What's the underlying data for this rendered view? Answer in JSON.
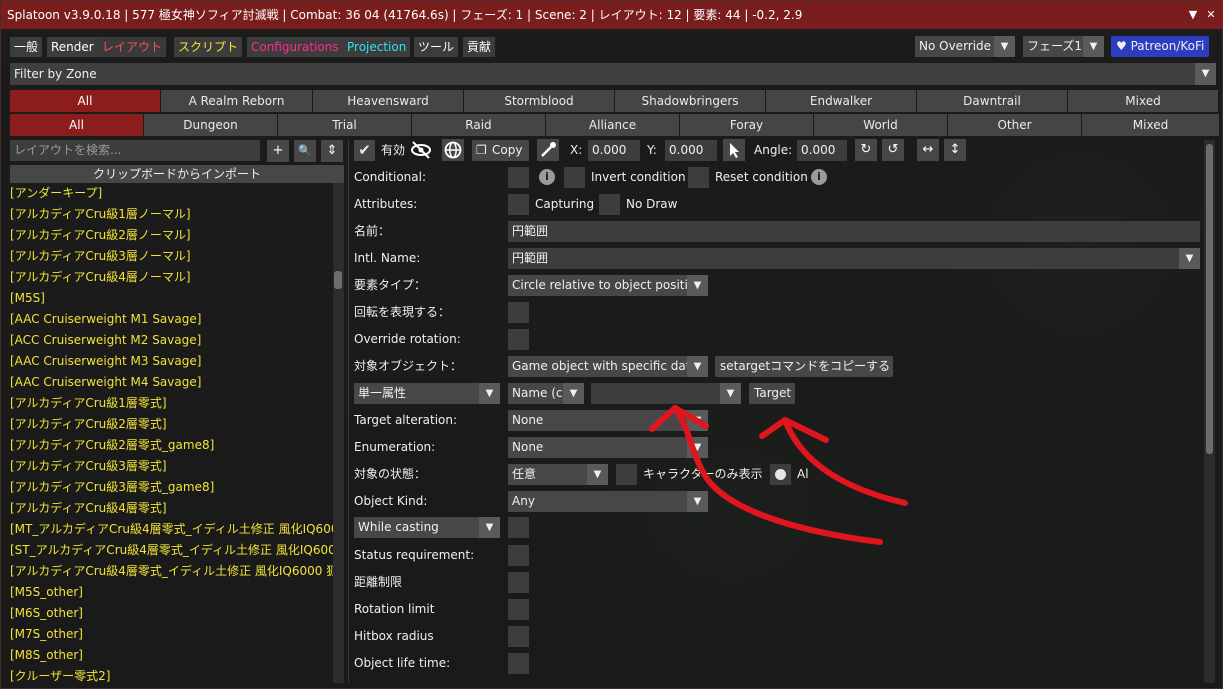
{
  "window": {
    "title": "Splatoon v3.9.0.18 | 577 極女神ソフィア討滅戦 | Combat: 36 04 (41764.6s) | フェーズ: 1 | Scene: 2 | レイアウト: 12 | 要素: 44 | -0.2, 2.9",
    "collapse_glyph": "▼",
    "close_glyph": "✕"
  },
  "menu_tabs": [
    {
      "label": "一般",
      "color": "#ffffff"
    },
    {
      "label": "Render",
      "color": "#ffffff"
    },
    {
      "label": "レイアウト",
      "color": "#ff5252"
    },
    {
      "label": "スクリプト",
      "color": "#f5e82c"
    },
    {
      "label": "Configurations",
      "color": "#ff2c8f"
    },
    {
      "label": "Projection",
      "color": "#30e4ee"
    },
    {
      "label": "ツール",
      "color": "#ffffff"
    },
    {
      "label": "貢献",
      "color": "#ffffff"
    }
  ],
  "header_right": {
    "override_select": "No Override",
    "phase_select": "フェーズ1",
    "patreon_label": "♥ Patreon/KoFi",
    "patreon_color": "#2c3dbf"
  },
  "filter_by_zone": {
    "label": "Filter by Zone",
    "expansions": [
      "All",
      "A Realm Reborn",
      "Heavensward",
      "Stormblood",
      "Shadowbringers",
      "Endwalker",
      "Dawntrail",
      "Mixed"
    ],
    "content_types": [
      "All",
      "Dungeon",
      "Trial",
      "Raid",
      "Alliance",
      "Foray",
      "World",
      "Other",
      "Mixed"
    ]
  },
  "sidebar": {
    "search_placeholder": "レイアウトを検索...",
    "import_button": "クリップボードからインポート",
    "plus_glyph": "+",
    "search_glyph": "🔍",
    "sort_glyph": "⇕",
    "items": [
      "[アンダーキープ]",
      "[アルカディアCru級1層ノーマル]",
      "[アルカディアCru級2層ノーマル]",
      "[アルカディアCru級3層ノーマル]",
      "[アルカディアCru級4層ノーマル]",
      "[M5S]",
      "[AAC Cruiserweight M1 Savage]",
      "[ACC Cruiserweight M2 Savage]",
      "[AAC Cruiserweight M3 Savage]",
      "[AAC Cruiserweight M4 Savage]",
      "[アルカディアCru級1層零式]",
      "[アルカディアCru級2層零式]",
      "[アルカディアCru級2層零式_game8]",
      "[アルカディアCru級3層零式]",
      "[アルカディアCru級3層零式_game8]",
      "[アルカディアCru級4層零式]",
      "[MT_アルカディアCru級4層零式_イディル土修正 風化IQ6000",
      "[ST_アルカディアCru級4層零式_イディル土修正 風化IQ600",
      "[アルカディアCru級4層零式_イディル土修正 風化IQ6000 狐",
      "[M5S_other]",
      "[M6S_other]",
      "[M7S_other]",
      "[M8S_other]",
      "[クルーザー零式2]"
    ]
  },
  "toolbar": {
    "enabled_label": "有効",
    "copy_label": "Copy",
    "x_label": "X:",
    "x_value": "0.000",
    "y_label": "Y:",
    "y_value": "0.000",
    "angle_label": "Angle:",
    "angle_value": "0.000"
  },
  "form": {
    "conditional_label": "Conditional:",
    "invert_condition": "Invert condition",
    "reset_condition": "Reset condition",
    "attributes_label": "Attributes:",
    "capturing": "Capturing",
    "no_draw": "No Draw",
    "name_label": "名前：",
    "name_value": "円範囲",
    "intl_name_label": "Intl. Name:",
    "intl_name_value": "円範囲",
    "element_type_label": "要素タイプ：",
    "element_type_value": "Circle relative to object positio",
    "rotation_label": "回転を表現する：",
    "override_rotation_label": "Override rotation:",
    "target_object_label": "対象オブジェクト：",
    "target_object_value": "Game object with specific data",
    "copy_settarget_button": "setargetコマンドをコピーする",
    "single_attr_value": "単一属性",
    "name_c_value": "Name (c",
    "attr_value": "",
    "target_button": "Target",
    "target_alteration_label": "Target alteration:",
    "target_alteration_value": "None",
    "enumeration_label": "Enumeration:",
    "enumeration_value": "None",
    "target_state_label": "対象の状態：",
    "target_state_value": "任意",
    "char_only_label": "キャラクターのみ表示",
    "all_label": "Al",
    "object_kind_label": "Object Kind:",
    "object_kind_value": "Any",
    "while_casting_value": "While casting",
    "status_req_label": "Status requirement:",
    "distance_limit_label": "距離制限",
    "rotation_limit_label": "Rotation limit",
    "hitbox_radius_label": "Hitbox radius",
    "object_life_label": "Object life time:"
  },
  "colors": {
    "title_bar": "#7a1d1d",
    "active_tab": "#8b1d1d",
    "list_text": "#f3e23a",
    "annotation": "#e0161e"
  }
}
